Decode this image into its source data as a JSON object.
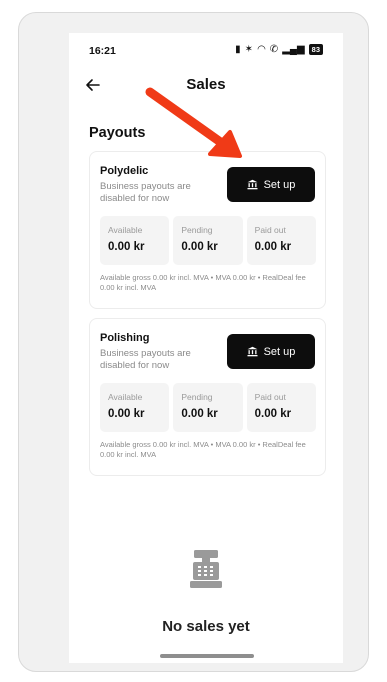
{
  "status_bar": {
    "time": "16:21",
    "battery": "83"
  },
  "header": {
    "title": "Sales",
    "back_icon": "arrow-left-icon"
  },
  "payouts": {
    "section_title": "Payouts",
    "stores": [
      {
        "name": "Polydelic",
        "description": "Business payouts are disabled for now",
        "button_label": "Set up",
        "button_icon": "bank-icon",
        "stats": [
          {
            "label": "Available",
            "value": "0.00 kr"
          },
          {
            "label": "Pending",
            "value": "0.00 kr"
          },
          {
            "label": "Paid out",
            "value": "0.00 kr"
          }
        ],
        "footnote": "Available gross 0.00 kr incl. MVA • MVA 0.00 kr • RealDeal fee 0.00 kr incl. MVA"
      },
      {
        "name": "Polishing",
        "description": "Business payouts are disabled for now",
        "button_label": "Set up",
        "button_icon": "bank-icon",
        "stats": [
          {
            "label": "Available",
            "value": "0.00 kr"
          },
          {
            "label": "Pending",
            "value": "0.00 kr"
          },
          {
            "label": "Paid out",
            "value": "0.00 kr"
          }
        ],
        "footnote": "Available gross 0.00 kr incl. MVA • MVA 0.00 kr • RealDeal fee 0.00 kr incl. MVA"
      }
    ]
  },
  "empty_state": {
    "icon": "cash-register-icon",
    "title": "No sales yet"
  },
  "colors": {
    "button_bg": "#0d0d0d",
    "annotation_arrow": "#f03a17",
    "muted_text": "#8a8a8a"
  }
}
